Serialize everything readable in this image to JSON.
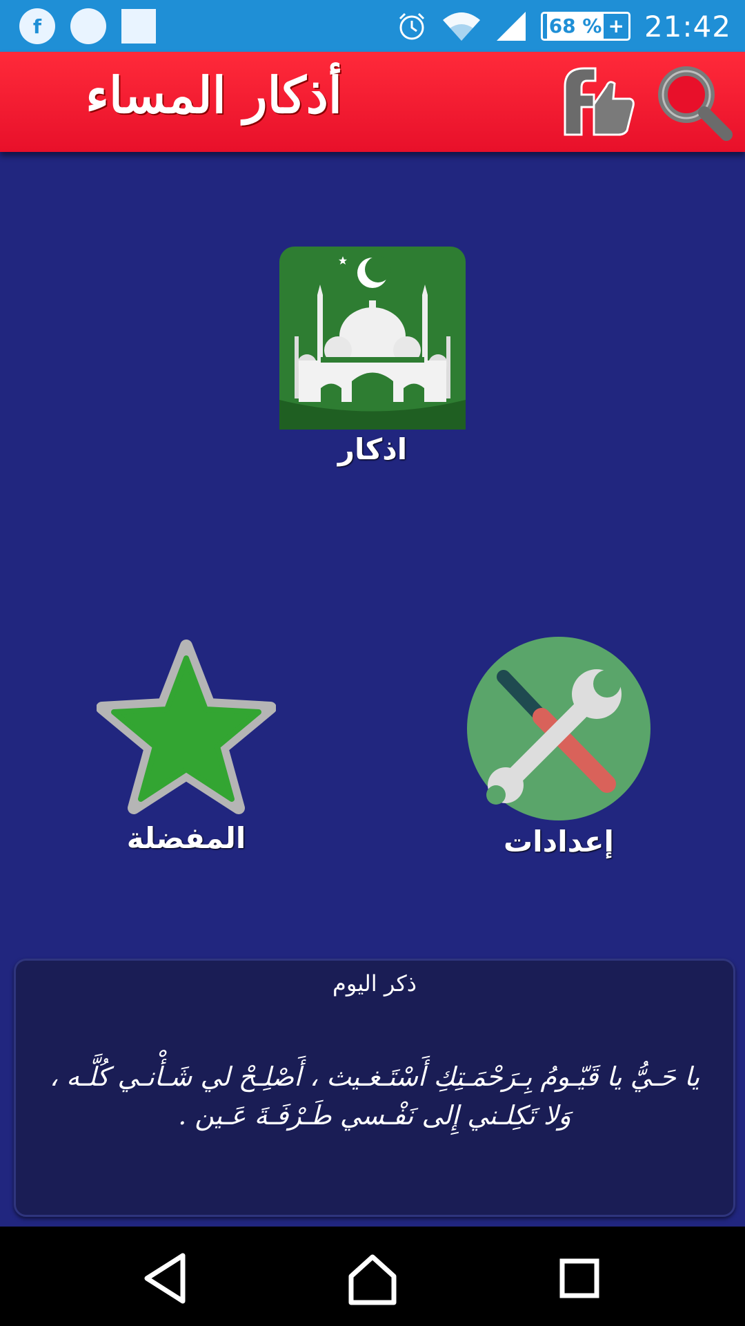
{
  "status_bar": {
    "time": "21:42",
    "battery": "68 %",
    "left_icon_glyph": "f"
  },
  "app_bar": {
    "title": "أذكار المساء",
    "facebook_like_icon": "facebook-like-icon",
    "search_icon": "search-icon"
  },
  "tiles": {
    "azkar": {
      "label": "اذكار",
      "icon": "mosque-icon"
    },
    "favorites": {
      "label": "المفضلة",
      "icon": "star-icon"
    },
    "settings": {
      "label": "إعدادات",
      "icon": "tools-icon"
    }
  },
  "daily_dhikr": {
    "title": "ذكر اليوم",
    "text": "يا حَـيُّ يا قَيّـومُ بِـرَحْمَـتِكِ أَسْتَـغـيث ، أَصْلِـحْ لي شَـأْنـي كُلَّـه ، وَلا تَكِلـني إِلى نَفْـسي طَـرْفَـةَ عَـين ."
  },
  "colors": {
    "status_bar": "#1f8fd6",
    "app_bar": "#e8102a",
    "background": "#21267f",
    "card": "#1a1d55",
    "green": "#2e7d32"
  }
}
